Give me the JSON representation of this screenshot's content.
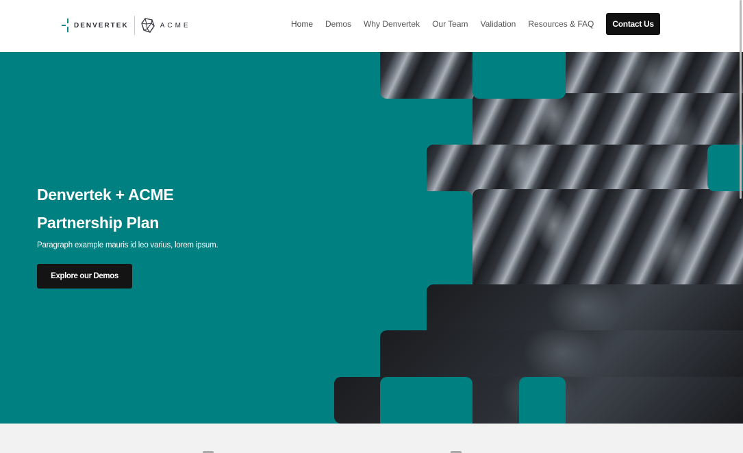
{
  "header": {
    "logo_primary": "DENVERTEK",
    "logo_secondary": "ACME",
    "nav": [
      {
        "label": "Home"
      },
      {
        "label": "Demos"
      },
      {
        "label": "Why Denvertek"
      },
      {
        "label": "Our Team"
      },
      {
        "label": "Validation"
      },
      {
        "label": "Resources & FAQ"
      }
    ],
    "cta_label": "Contact Us"
  },
  "hero": {
    "title_line1": "Denvertek + ACME",
    "title_line2": "Partnership Plan",
    "paragraph": "Paragraph example mauris id leo varius, lorem ipsum.",
    "button_label": "Explore our Demos",
    "image_alt": "Rows of dark chairs"
  },
  "colors": {
    "brand_teal": "#008080",
    "button_dark": "#141414",
    "band_background": "#f2f2f2"
  }
}
